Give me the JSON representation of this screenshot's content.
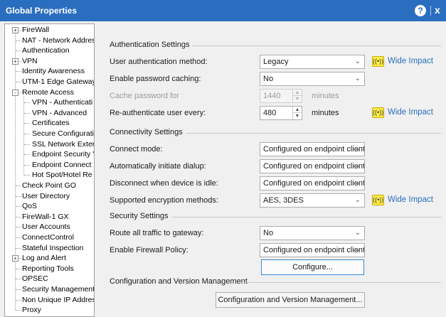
{
  "window": {
    "title": "Global Properties",
    "help_glyph": "?",
    "close_glyph": "x"
  },
  "tree": {
    "items": [
      {
        "label": "FireWall",
        "expander": "+"
      },
      {
        "label": "NAT - Network Addres"
      },
      {
        "label": "Authentication"
      },
      {
        "label": "VPN",
        "expander": "+"
      },
      {
        "label": "Identity Awareness"
      },
      {
        "label": "UTM-1 Edge Gateway"
      },
      {
        "label": "Remote Access",
        "expander": "-"
      },
      {
        "label": "VPN - Authenticati"
      },
      {
        "label": "VPN - Advanced"
      },
      {
        "label": "Certificates"
      },
      {
        "label": "Secure Configurati"
      },
      {
        "label": "SSL Network Exter"
      },
      {
        "label": "Endpoint Security '"
      },
      {
        "label": "Endpoint Connect"
      },
      {
        "label": "Hot Spot/Hotel Re"
      },
      {
        "label": "Check Point GO"
      },
      {
        "label": "User Directory"
      },
      {
        "label": "QoS"
      },
      {
        "label": "FireWall-1 GX"
      },
      {
        "label": "User Accounts"
      },
      {
        "label": "ConnectControl"
      },
      {
        "label": "Stateful Inspection"
      },
      {
        "label": "Log and Alert",
        "expander": "+"
      },
      {
        "label": "Reporting Tools"
      },
      {
        "label": "OPSEC"
      },
      {
        "label": "Security Management ."
      },
      {
        "label": "Non Unique IP Addres"
      },
      {
        "label": "Proxy"
      }
    ]
  },
  "auth": {
    "section_title": "Authentication Settings",
    "method_label": "User authentication method:",
    "method_value": "Legacy",
    "caching_label": "Enable password caching:",
    "caching_value": "No",
    "cache_for_label": "Cache password for",
    "cache_for_value": "1440",
    "cache_for_unit": "minutes",
    "reauth_label": "Re-authenticate user every:",
    "reauth_value": "480",
    "reauth_unit": "minutes"
  },
  "connectivity": {
    "section_title": "Connectivity Settings",
    "connect_mode_label": "Connect mode:",
    "connect_mode_value": "Configured on endpoint client",
    "auto_dialup_label": "Automatically initiate dialup:",
    "auto_dialup_value": "Configured on endpoint client",
    "disconnect_idle_label": "Disconnect when device is idle:",
    "disconnect_idle_value": "Configured on endpoint client",
    "encryption_label": "Supported encryption methods:",
    "encryption_value": "AES, 3DES"
  },
  "security": {
    "section_title": "Security Settings",
    "route_label": "Route all traffic to gateway:",
    "route_value": "No",
    "firewall_label": "Enable Firewall Policy:",
    "firewall_value": "Configured on endpoint client",
    "configure_button": "Configure..."
  },
  "config_mgmt": {
    "section_title": "Configuration and Version Management",
    "button_label": "Configuration and Version Management..."
  },
  "impact": {
    "link_text": "Wide Impact",
    "icon_glyph": "((•))",
    "link_color": "#2a6ebf",
    "icon_color": "#fff04a"
  },
  "colors": {
    "titlebar": "#2a6ebf"
  },
  "chevron_glyph": "⌄",
  "spin_up": "▲",
  "spin_down": "▼"
}
